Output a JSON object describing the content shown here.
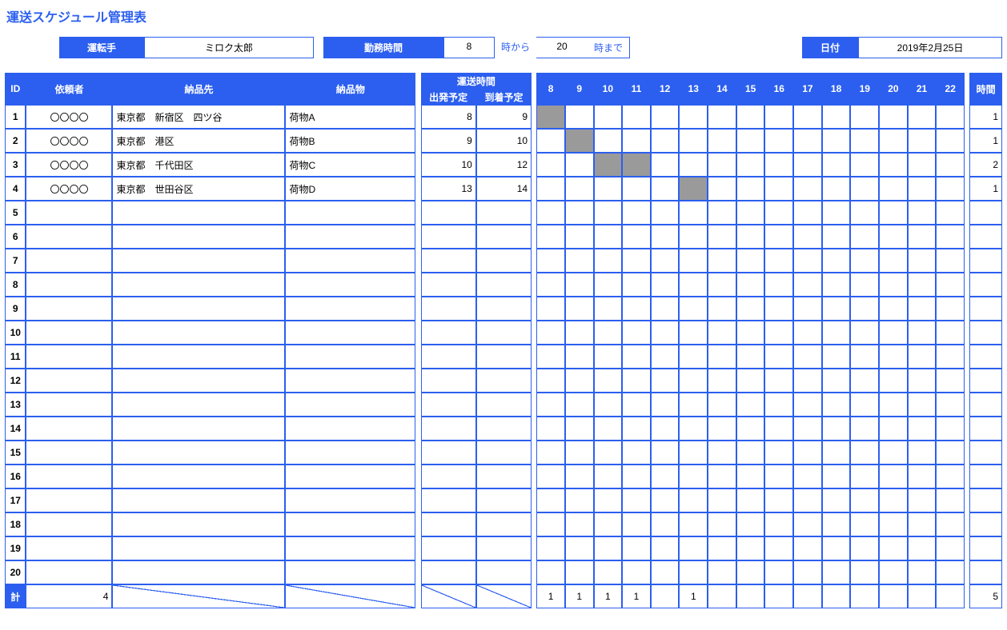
{
  "title": "運送スケジュール管理表",
  "top": {
    "driver_label": "運転手",
    "driver_name": "ミロク太郎",
    "hours_label": "勤務時間",
    "from_hour": "8",
    "from_suffix": "時から",
    "to_hour": "20",
    "to_suffix": "時まで",
    "date_label": "日付",
    "date_value": "2019年2月25日"
  },
  "headers": {
    "id": "ID",
    "requester": "依頼者",
    "destination": "納品先",
    "item": "納品物",
    "transport_time": "運送時間",
    "departure": "出発予定",
    "arrival": "到着予定",
    "duration": "時間"
  },
  "hour_columns": [
    "8",
    "9",
    "10",
    "11",
    "12",
    "13",
    "14",
    "15",
    "16",
    "17",
    "18",
    "19",
    "20",
    "21",
    "22"
  ],
  "chart_data": {
    "type": "table",
    "title": "運送スケジュール管理表",
    "columns": [
      "ID",
      "依頼者",
      "納品先",
      "納品物",
      "出発予定",
      "到着予定",
      "時間"
    ],
    "rows": [
      {
        "id": 1,
        "requester": "〇〇〇〇",
        "destination": "東京都　新宿区　四ツ谷",
        "item": "荷物A",
        "dep": 8,
        "arr": 9,
        "duration": 1
      },
      {
        "id": 2,
        "requester": "〇〇〇〇",
        "destination": "東京都　港区",
        "item": "荷物B",
        "dep": 9,
        "arr": 10,
        "duration": 1
      },
      {
        "id": 3,
        "requester": "〇〇〇〇",
        "destination": "東京都　千代田区",
        "item": "荷物C",
        "dep": 10,
        "arr": 12,
        "duration": 2
      },
      {
        "id": 4,
        "requester": "〇〇〇〇",
        "destination": "東京都　世田谷区",
        "item": "荷物D",
        "dep": 13,
        "arr": 14,
        "duration": 1
      }
    ],
    "hour_range": [
      8,
      22
    ],
    "hour_totals": {
      "8": 1,
      "9": 1,
      "10": 1,
      "11": 1,
      "13": 1
    },
    "totals": {
      "count": 4,
      "duration": 5
    }
  },
  "rows": [
    {
      "id": "1",
      "requester": "〇〇〇〇",
      "destination": "東京都　新宿区　四ツ谷",
      "item": "荷物A",
      "dep": "8",
      "arr": "9",
      "bars": [
        8
      ],
      "duration": "1"
    },
    {
      "id": "2",
      "requester": "〇〇〇〇",
      "destination": "東京都　港区",
      "item": "荷物B",
      "dep": "9",
      "arr": "10",
      "bars": [
        9
      ],
      "duration": "1"
    },
    {
      "id": "3",
      "requester": "〇〇〇〇",
      "destination": "東京都　千代田区",
      "item": "荷物C",
      "dep": "10",
      "arr": "12",
      "bars": [
        10,
        11
      ],
      "duration": "2"
    },
    {
      "id": "4",
      "requester": "〇〇〇〇",
      "destination": "東京都　世田谷区",
      "item": "荷物D",
      "dep": "13",
      "arr": "14",
      "bars": [
        13
      ],
      "duration": "1"
    },
    {
      "id": "5"
    },
    {
      "id": "6"
    },
    {
      "id": "7"
    },
    {
      "id": "8"
    },
    {
      "id": "9"
    },
    {
      "id": "10"
    },
    {
      "id": "11"
    },
    {
      "id": "12"
    },
    {
      "id": "13"
    },
    {
      "id": "14"
    },
    {
      "id": "15"
    },
    {
      "id": "16"
    },
    {
      "id": "17"
    },
    {
      "id": "18"
    },
    {
      "id": "19"
    },
    {
      "id": "20"
    }
  ],
  "totals": {
    "label": "計",
    "count": "4",
    "hours": {
      "8": "1",
      "9": "1",
      "10": "1",
      "11": "1",
      "12": "",
      "13": "1",
      "14": "",
      "15": "",
      "16": "",
      "17": "",
      "18": "",
      "19": "",
      "20": "",
      "21": "",
      "22": ""
    },
    "duration": "5"
  }
}
